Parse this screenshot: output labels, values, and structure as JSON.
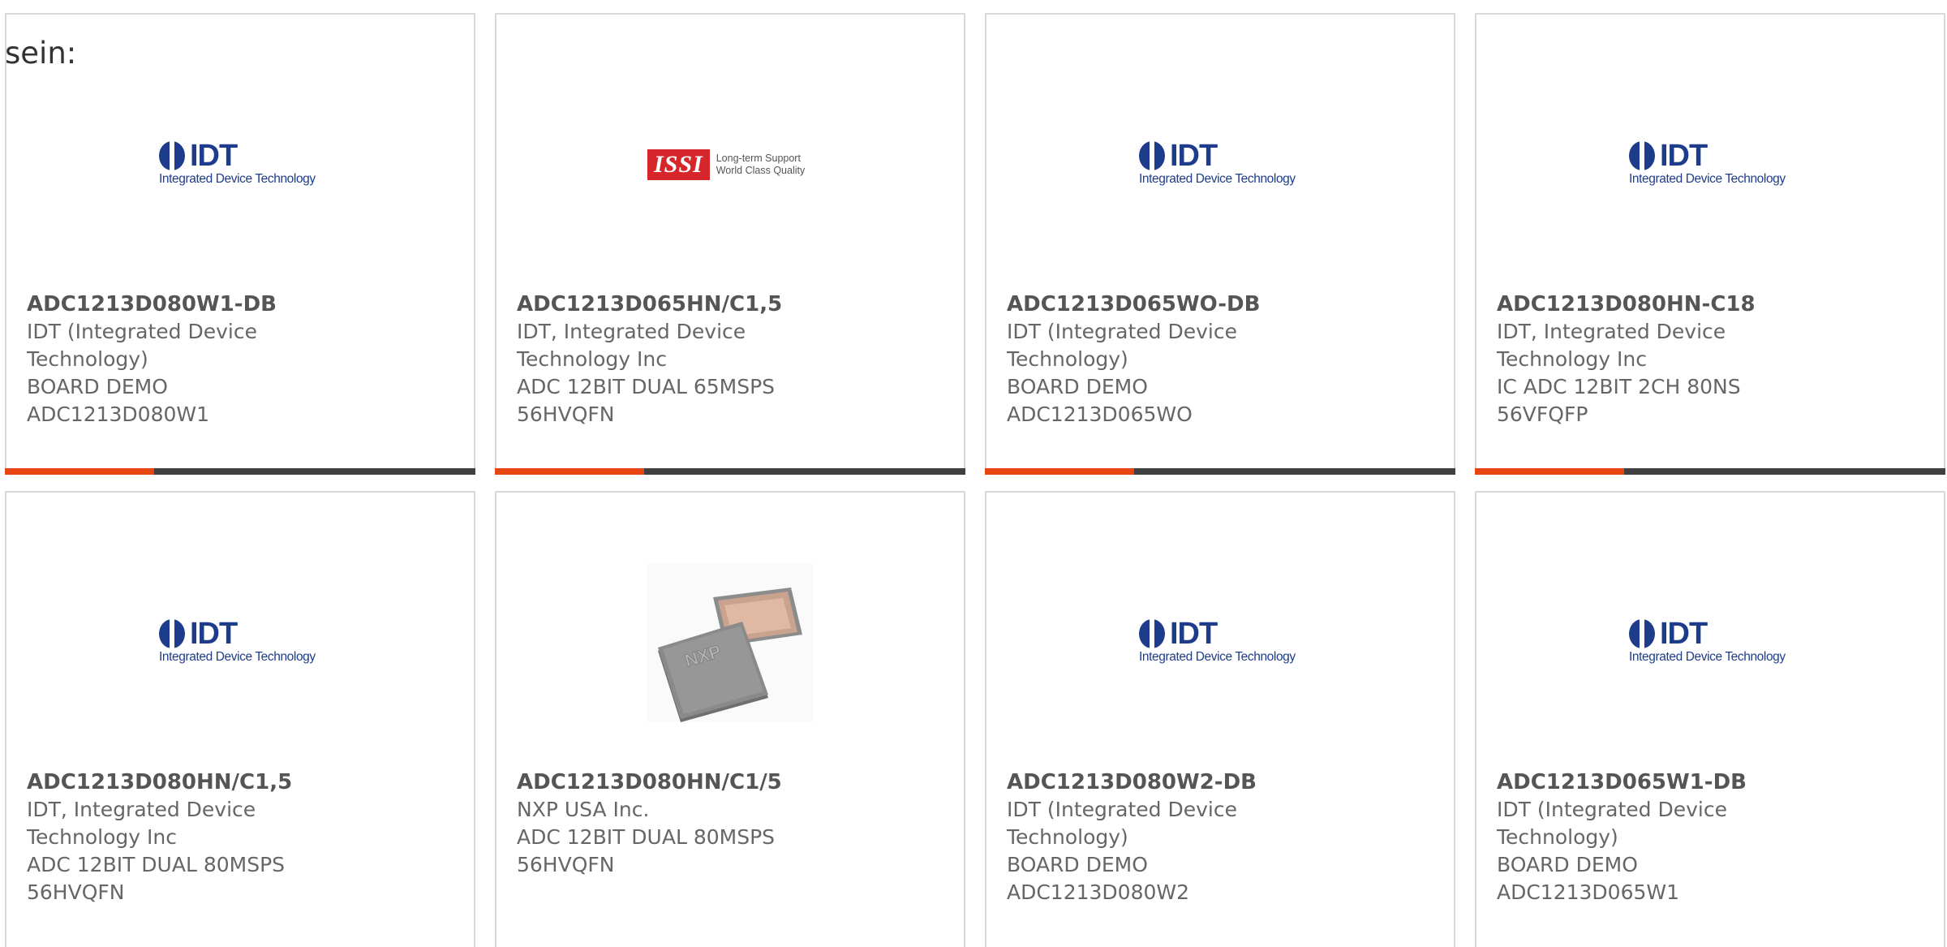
{
  "intro": "sein:",
  "colors": {
    "accent": "#e64512",
    "bar": "#404040",
    "border": "#d9d9d9",
    "idt_blue": "#1d3c8c",
    "issi_red": "#d6262c"
  },
  "logos": {
    "idt": {
      "word": "IDT",
      "tagline": "Integrated Device Technology"
    },
    "issi": {
      "word": "ISSI",
      "tagline_1": "Long-term Support",
      "tagline_2": "World Class Quality"
    },
    "nxp": {
      "word": "NXP"
    }
  },
  "products": [
    {
      "part": "ADC1213D080W1-DB",
      "manufacturer": "IDT (Integrated Device Technology)",
      "description": "BOARD DEMO ADC1213D080W1",
      "image": "idt-logo"
    },
    {
      "part": "ADC1213D065HN/C1,5",
      "manufacturer": "IDT, Integrated Device Technology Inc",
      "description": "ADC 12BIT DUAL 65MSPS 56HVQFN",
      "image": "issi-logo"
    },
    {
      "part": "ADC1213D065WO-DB",
      "manufacturer": "IDT (Integrated Device Technology)",
      "description": "BOARD DEMO ADC1213D065WO",
      "image": "idt-logo"
    },
    {
      "part": "ADC1213D080HN-C18",
      "manufacturer": "IDT, Integrated Device Technology Inc",
      "description": "IC ADC 12BIT 2CH 80NS 56VFQFP",
      "image": "idt-logo"
    },
    {
      "part": "ADC1213D080HN/C1,5",
      "manufacturer": "IDT, Integrated Device Technology Inc",
      "description": "ADC 12BIT DUAL 80MSPS 56HVQFN",
      "image": "idt-logo"
    },
    {
      "part": "ADC1213D080HN/C1/5",
      "manufacturer": "NXP USA Inc.",
      "description": "ADC 12BIT DUAL 80MSPS 56HVQFN",
      "image": "nxp-chip"
    },
    {
      "part": "ADC1213D080W2-DB",
      "manufacturer": "IDT (Integrated Device Technology)",
      "description": "BOARD DEMO ADC1213D080W2",
      "image": "idt-logo"
    },
    {
      "part": "ADC1213D065W1-DB",
      "manufacturer": "IDT (Integrated Device Technology)",
      "description": "BOARD DEMO ADC1213D065W1",
      "image": "idt-logo"
    }
  ]
}
